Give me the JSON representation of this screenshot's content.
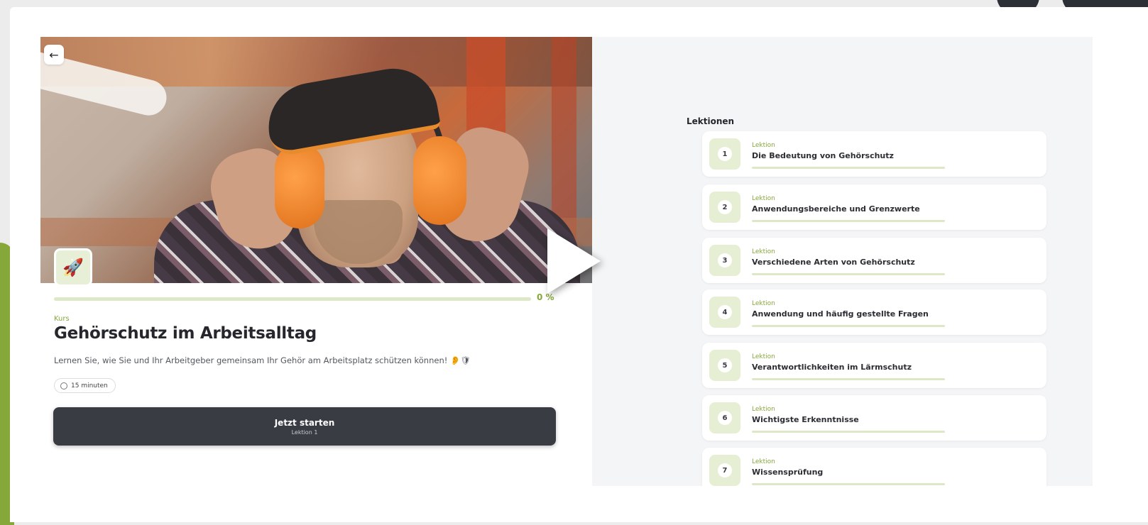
{
  "course": {
    "kicker": "Kurs",
    "title": "Gehörschutz im Arbeitsalltag",
    "description": "Lernen Sie, wie Sie und Ihr Arbeitgeber gemeinsam Ihr Gehör am Arbeitsplatz schützen können! 👂🛡",
    "duration": "15 minuten",
    "progress_label": "0 %",
    "progress_fraction": 0,
    "badge_icon": "rocket-icon",
    "back_icon": "arrow-left-icon",
    "start_button": {
      "label": "Jetzt starten",
      "sublabel": "Lektion 1"
    }
  },
  "lessons": {
    "heading": "Lektionen",
    "items": [
      {
        "number": "1",
        "kind": "Lektion",
        "title": "Die Bedeutung von Gehörschutz"
      },
      {
        "number": "2",
        "kind": "Lektion",
        "title": "Anwendungsbereiche und Grenzwerte"
      },
      {
        "number": "3",
        "kind": "Lektion",
        "title": "Verschiedene Arten von Gehörschutz"
      },
      {
        "number": "4",
        "kind": "Lektion",
        "title": "Anwendung und häufig gestellte Fragen"
      },
      {
        "number": "5",
        "kind": "Lektion",
        "title": "Verantwortlichkeiten im Lärmschutz"
      },
      {
        "number": "6",
        "kind": "Lektion",
        "title": "Wichtigste Erkenntnisse"
      },
      {
        "number": "7",
        "kind": "Lektion",
        "title": "Wissensprüfung"
      }
    ]
  },
  "colors": {
    "accent": "#86a83a",
    "accent_light": "#e6efd4",
    "button_dark": "#3a3c44"
  }
}
